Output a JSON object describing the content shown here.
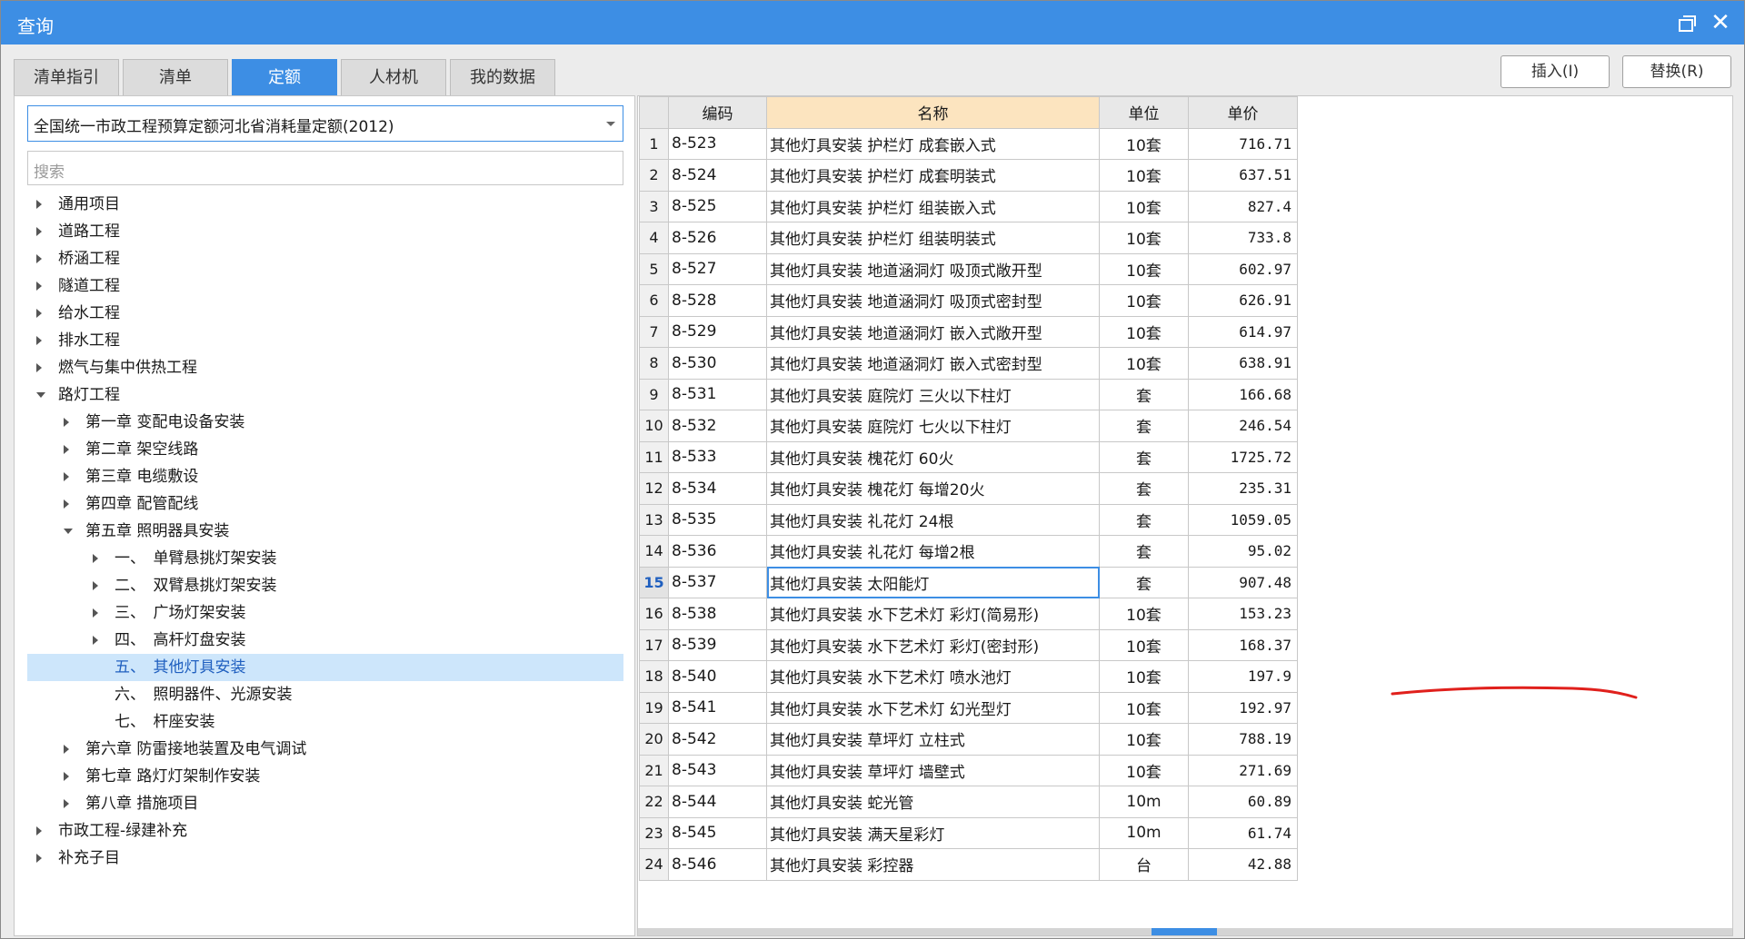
{
  "window": {
    "title": "查询",
    "restore_icon": "restore-icon",
    "close_label": "✕"
  },
  "tabs": [
    {
      "label": "清单指引",
      "active": false
    },
    {
      "label": "清单",
      "active": false
    },
    {
      "label": "定额",
      "active": true
    },
    {
      "label": "人材机",
      "active": false
    },
    {
      "label": "我的数据",
      "active": false
    }
  ],
  "actions": {
    "insert_label": "插入(I)",
    "replace_label": "替换(R)"
  },
  "library_select": {
    "value": "全国统一市政工程预算定额河北省消耗量定额(2012)"
  },
  "search": {
    "placeholder": "搜索"
  },
  "tree": [
    {
      "label": "通用项目",
      "level": 0,
      "state": "closed"
    },
    {
      "label": "道路工程",
      "level": 0,
      "state": "closed"
    },
    {
      "label": "桥涵工程",
      "level": 0,
      "state": "closed"
    },
    {
      "label": "隧道工程",
      "level": 0,
      "state": "closed"
    },
    {
      "label": "给水工程",
      "level": 0,
      "state": "closed"
    },
    {
      "label": "排水工程",
      "level": 0,
      "state": "closed"
    },
    {
      "label": "燃气与集中供热工程",
      "level": 0,
      "state": "closed"
    },
    {
      "label": "路灯工程",
      "level": 0,
      "state": "open"
    },
    {
      "label": "第一章 变配电设备安装",
      "level": 1,
      "state": "closed"
    },
    {
      "label": "第二章 架空线路",
      "level": 1,
      "state": "closed"
    },
    {
      "label": "第三章 电缆敷设",
      "level": 1,
      "state": "closed"
    },
    {
      "label": "第四章 配管配线",
      "level": 1,
      "state": "closed"
    },
    {
      "label": "第五章 照明器具安装",
      "level": 1,
      "state": "open"
    },
    {
      "label": "一、　单臂悬挑灯架安装",
      "level": 2,
      "state": "closed"
    },
    {
      "label": "二、　双臂悬挑灯架安装",
      "level": 2,
      "state": "closed"
    },
    {
      "label": "三、　广场灯架安装",
      "level": 2,
      "state": "closed"
    },
    {
      "label": "四、　高杆灯盘安装",
      "level": 2,
      "state": "closed"
    },
    {
      "label": "五、　其他灯具安装",
      "level": 2,
      "state": "leaf",
      "selected": true
    },
    {
      "label": "六、　照明器件、光源安装",
      "level": 2,
      "state": "leaf"
    },
    {
      "label": "七、　杆座安装",
      "level": 2,
      "state": "leaf"
    },
    {
      "label": "第六章 防雷接地装置及电气调试",
      "level": 1,
      "state": "closed"
    },
    {
      "label": "第七章 路灯灯架制作安装",
      "level": 1,
      "state": "closed"
    },
    {
      "label": "第八章 措施项目",
      "level": 1,
      "state": "closed"
    },
    {
      "label": "市政工程-绿建补充",
      "level": 0,
      "state": "closed"
    },
    {
      "label": "补充子目",
      "level": 0,
      "state": "closed"
    }
  ],
  "grid": {
    "columns": [
      "编码",
      "名称",
      "单位",
      "单价"
    ],
    "current_row": 15,
    "rows": [
      {
        "no": "1",
        "code": "8-523",
        "name": "其他灯具安装 护栏灯 成套嵌入式",
        "unit": "10套",
        "price": "716.71"
      },
      {
        "no": "2",
        "code": "8-524",
        "name": "其他灯具安装 护栏灯 成套明装式",
        "unit": "10套",
        "price": "637.51"
      },
      {
        "no": "3",
        "code": "8-525",
        "name": "其他灯具安装 护栏灯 组装嵌入式",
        "unit": "10套",
        "price": "827.4"
      },
      {
        "no": "4",
        "code": "8-526",
        "name": "其他灯具安装 护栏灯 组装明装式",
        "unit": "10套",
        "price": "733.8"
      },
      {
        "no": "5",
        "code": "8-527",
        "name": "其他灯具安装 地道涵洞灯 吸顶式敞开型",
        "unit": "10套",
        "price": "602.97"
      },
      {
        "no": "6",
        "code": "8-528",
        "name": "其他灯具安装 地道涵洞灯 吸顶式密封型",
        "unit": "10套",
        "price": "626.91"
      },
      {
        "no": "7",
        "code": "8-529",
        "name": "其他灯具安装 地道涵洞灯 嵌入式敞开型",
        "unit": "10套",
        "price": "614.97"
      },
      {
        "no": "8",
        "code": "8-530",
        "name": "其他灯具安装 地道涵洞灯 嵌入式密封型",
        "unit": "10套",
        "price": "638.91"
      },
      {
        "no": "9",
        "code": "8-531",
        "name": "其他灯具安装 庭院灯 三火以下柱灯",
        "unit": "套",
        "price": "166.68"
      },
      {
        "no": "10",
        "code": "8-532",
        "name": "其他灯具安装 庭院灯 七火以下柱灯",
        "unit": "套",
        "price": "246.54"
      },
      {
        "no": "11",
        "code": "8-533",
        "name": "其他灯具安装 槐花灯 60火",
        "unit": "套",
        "price": "1725.72"
      },
      {
        "no": "12",
        "code": "8-534",
        "name": "其他灯具安装 槐花灯 每增20火",
        "unit": "套",
        "price": "235.31"
      },
      {
        "no": "13",
        "code": "8-535",
        "name": "其他灯具安装 礼花灯 24根",
        "unit": "套",
        "price": "1059.05"
      },
      {
        "no": "14",
        "code": "8-536",
        "name": "其他灯具安装 礼花灯 每增2根",
        "unit": "套",
        "price": "95.02"
      },
      {
        "no": "15",
        "code": "8-537",
        "name": "其他灯具安装 太阳能灯",
        "unit": "套",
        "price": "907.48"
      },
      {
        "no": "16",
        "code": "8-538",
        "name": "其他灯具安装 水下艺术灯 彩灯(简易形)",
        "unit": "10套",
        "price": "153.23"
      },
      {
        "no": "17",
        "code": "8-539",
        "name": "其他灯具安装 水下艺术灯 彩灯(密封形)",
        "unit": "10套",
        "price": "168.37"
      },
      {
        "no": "18",
        "code": "8-540",
        "name": "其他灯具安装 水下艺术灯 喷水池灯",
        "unit": "10套",
        "price": "197.9"
      },
      {
        "no": "19",
        "code": "8-541",
        "name": "其他灯具安装 水下艺术灯 幻光型灯",
        "unit": "10套",
        "price": "192.97"
      },
      {
        "no": "20",
        "code": "8-542",
        "name": "其他灯具安装 草坪灯 立柱式",
        "unit": "10套",
        "price": "788.19"
      },
      {
        "no": "21",
        "code": "8-543",
        "name": "其他灯具安装 草坪灯 墙壁式",
        "unit": "10套",
        "price": "271.69"
      },
      {
        "no": "22",
        "code": "8-544",
        "name": "其他灯具安装 蛇光管",
        "unit": "10m",
        "price": "60.89"
      },
      {
        "no": "23",
        "code": "8-545",
        "name": "其他灯具安装 满天星彩灯",
        "unit": "10m",
        "price": "61.74"
      },
      {
        "no": "24",
        "code": "8-546",
        "name": "其他灯具安装 彩控器",
        "unit": "台",
        "price": "42.88"
      }
    ]
  },
  "colors": {
    "accent": "#3d8ee4",
    "header_highlight": "#fce4bf",
    "annotation": "#e0201c"
  }
}
